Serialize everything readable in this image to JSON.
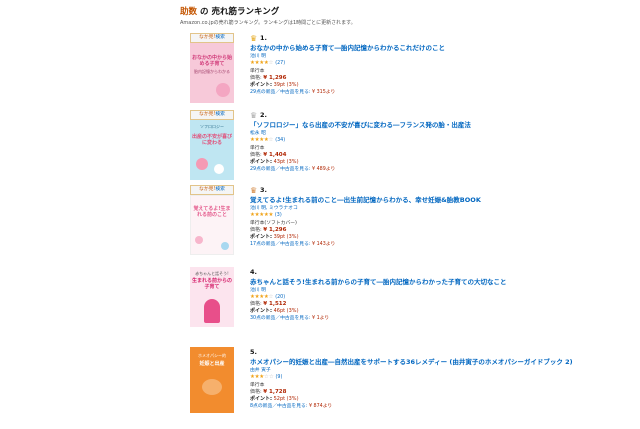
{
  "header": {
    "title_part1": "助数",
    "title_part2": "の 売れ筋ランキング",
    "subtitle": "Amazon.co.jpの売れ筋ランキング。ランキングは1時間ごとに更新されます。"
  },
  "items": [
    {
      "badge_part1": "なか見!",
      "badge_part2": "検索",
      "crown": "gold-crown",
      "rank": "1.",
      "title": "おなかの中から始める子育て―胎内記憶からわかるこれだけのこと",
      "author": "池川 明",
      "stars": "★★★★",
      "stars_empty": "☆",
      "review_count": "(27)",
      "format": "単行本",
      "price_label": "価格:",
      "price": "¥ 1,296",
      "points_label": "ポイント:",
      "points": "39pt (3%)",
      "used_text": "29点の新品／中古品を見る:",
      "used_price": "¥ 315より",
      "cover": {
        "title": "おなかの中から始める子育て",
        "sub": "胎内記憶からわかる",
        "bg": "#f7c9d9",
        "accent": "#d13b7a"
      }
    },
    {
      "badge_part1": "なか見!",
      "badge_part2": "検索",
      "crown": "silver-crown",
      "rank": "2.",
      "title": "「ソフロロジー」なら出産の不安が喜びに変わる―フランス発の胎・出産法",
      "author": "松永 昭",
      "stars": "★★★★",
      "stars_empty": "☆",
      "review_count": "(34)",
      "format": "単行本",
      "price_label": "価格:",
      "price": "¥ 1,404",
      "points_label": "ポイント:",
      "points": "43pt (3%)",
      "used_text": "29点の新品／中古品を見る:",
      "used_price": "¥ 489より",
      "cover": {
        "title": "出産の不安が喜びに変わる",
        "sub": "ソフロロジー",
        "bg": "#bfe6f2",
        "accent": "#e24d78"
      }
    },
    {
      "badge_part1": "なか見!",
      "badge_part2": "検索",
      "crown": "bronze-crown",
      "rank": "3.",
      "title": "覚えてるよ!生まれる前のこと―出生前記憶からわかる、幸せ妊娠&胎教BOOK",
      "author": "池川 明, ミウラナオコ",
      "stars": "★★★★★",
      "stars_empty": "",
      "review_count": "(3)",
      "format": "単行本(ソフトカバー)",
      "price_label": "価格:",
      "price": "¥ 1,296",
      "points_label": "ポイント:",
      "points": "39pt (3%)",
      "used_text": "17点の新品／中古品を見る:",
      "used_price": "¥ 143より",
      "cover": {
        "title": "覚えてるよ!生まれる前のこと",
        "sub": "",
        "bg": "#fdf3f6",
        "accent": "#e45a8c"
      }
    },
    {
      "badge_part1": "",
      "badge_part2": "",
      "crown": "",
      "rank": "4.",
      "title": "赤ちゃんと話そう!生まれる前からの子育て―胎内記憶からわかった子育ての大切なこと",
      "author": "池川 明",
      "stars": "★★★★",
      "stars_empty": "☆",
      "review_count": "(20)",
      "format": "単行本",
      "price_label": "価格:",
      "price": "¥ 1,512",
      "points_label": "ポイント:",
      "points": "46pt (3%)",
      "used_text": "30点の新品／中古品を見る:",
      "used_price": "¥ 1より",
      "cover": {
        "title": "生まれる前からの子育て",
        "sub": "赤ちゃんと話そう!",
        "bg": "#fce4ee",
        "accent": "#d6246e"
      }
    },
    {
      "badge_part1": "",
      "badge_part2": "",
      "crown": "",
      "rank": "5.",
      "title": "ホメオパシー的妊娠と出産―自然出産をサポートする36レメディー (由井寅子のホメオパシーガイドブック 2)",
      "author": "由井 寅子",
      "stars": "★★★",
      "stars_empty": "☆☆",
      "review_count": "(9)",
      "format": "単行本",
      "price_label": "価格:",
      "price": "¥ 1,728",
      "points_label": "ポイント:",
      "points": "52pt (3%)",
      "used_text": "8点の新品／中古品を見る:",
      "used_price": "¥ 874より",
      "cover": {
        "title": "妊娠と出産",
        "sub": "ホメオパシー的",
        "bg": "#f28c2e",
        "accent": "#ffffff"
      }
    }
  ]
}
